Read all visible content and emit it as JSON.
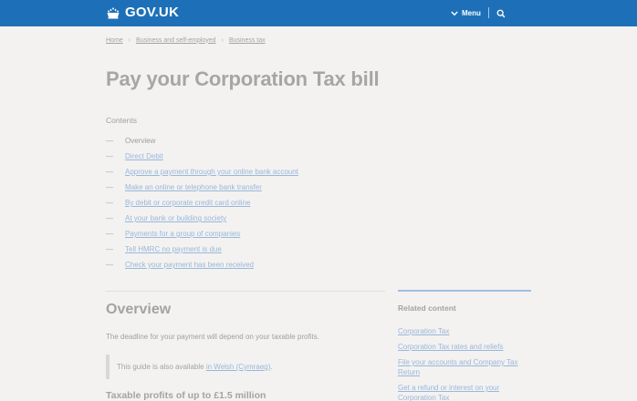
{
  "colors": {
    "header_bg": "#1d70b8",
    "page_bg": "#f3f2f1",
    "link": "#99b7d9"
  },
  "header": {
    "logo_text": "GOV.UK",
    "logo_icon": "crown-icon",
    "menu_label": "Menu",
    "menu_icon": "chevron-down-icon",
    "search_icon": "search-icon"
  },
  "breadcrumb": [
    "Home",
    "Business and self-employed",
    "Business tax"
  ],
  "title": "Pay your Corporation Tax bill",
  "contents": {
    "label": "Contents",
    "dash": "—",
    "items": [
      "Overview",
      "Direct Debit",
      "Approve a payment through your online bank account",
      "Make an online or telephone bank transfer",
      "By debit or corporate credit card online",
      "At your bank or building society",
      "Payments for a group of companies",
      "Tell HMRC no payment is due",
      "Check your payment has been received"
    ]
  },
  "overview": {
    "heading": "Overview",
    "paragraph": "The deadline for your payment will depend on your taxable profits.",
    "inset_text": "This guide is also available",
    "inset_link": "in Welsh (Cymraeg)",
    "inset_end": ".",
    "subheading": "Taxable profits of up to £1.5 million"
  },
  "related": {
    "heading": "Related content",
    "items": [
      "Corporation Tax",
      "Corporation Tax rates and reliefs",
      "File your accounts and Company Tax Return",
      "Get a refund or interest on your Corporation Tax"
    ]
  }
}
